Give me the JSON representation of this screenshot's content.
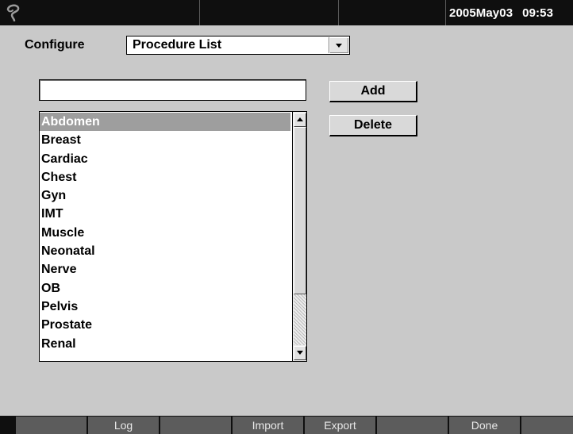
{
  "header": {
    "date": "2005May03",
    "time": "09:53",
    "logo_icon": "sonosite-logo-icon"
  },
  "configure": {
    "label": "Configure",
    "selected": "Procedure List"
  },
  "input": {
    "value": ""
  },
  "buttons": {
    "add": "Add",
    "delete": "Delete"
  },
  "procedures": {
    "items": [
      "Abdomen",
      "Breast",
      "Cardiac",
      "Chest",
      "Gyn",
      "IMT",
      "Muscle",
      "Neonatal",
      "Nerve",
      "OB",
      "Pelvis",
      "Prostate",
      "Renal"
    ],
    "selected_index": 0
  },
  "softkeys": [
    "",
    "Log",
    "",
    "Import",
    "Export",
    "",
    "Done",
    ""
  ],
  "colors": {
    "background": "#c9c9c9",
    "bar": "#0f0f0f",
    "softkey": "#5c5c5c",
    "selection": "#9e9e9e"
  }
}
